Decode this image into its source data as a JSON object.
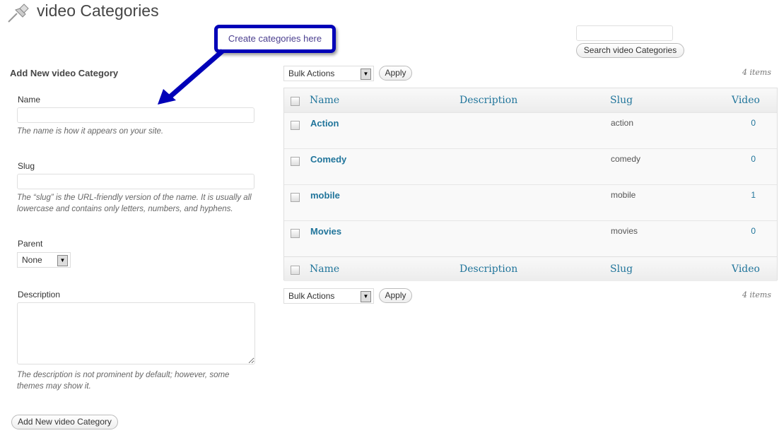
{
  "page": {
    "title": "video Categories"
  },
  "callout": {
    "text": "Create categories here",
    "color": "#0000b8"
  },
  "form": {
    "heading": "Add New video Category",
    "name_label": "Name",
    "name_value": "",
    "name_hint": "The name is how it appears on your site.",
    "slug_label": "Slug",
    "slug_value": "",
    "slug_hint": "The “slug” is the URL-friendly version of the name. It is usually all lowercase and contains only letters, numbers, and hyphens.",
    "parent_label": "Parent",
    "parent_value": "None",
    "description_label": "Description",
    "description_value": "",
    "description_hint": "The description is not prominent by default; however, some themes may show it.",
    "submit_label": "Add New video Category"
  },
  "search": {
    "value": "",
    "button_label": "Search video Categories"
  },
  "toolbar": {
    "bulk_actions": "Bulk Actions",
    "apply_label": "Apply",
    "items_count": "4 items"
  },
  "table": {
    "columns": [
      "Name",
      "Description",
      "Slug",
      "Video"
    ],
    "rows": [
      {
        "name": "Action",
        "description": "",
        "slug": "action",
        "count": "0"
      },
      {
        "name": "Comedy",
        "description": "",
        "slug": "comedy",
        "count": "0"
      },
      {
        "name": "mobile",
        "description": "",
        "slug": "mobile",
        "count": "1"
      },
      {
        "name": "Movies",
        "description": "",
        "slug": "movies",
        "count": "0"
      }
    ]
  }
}
